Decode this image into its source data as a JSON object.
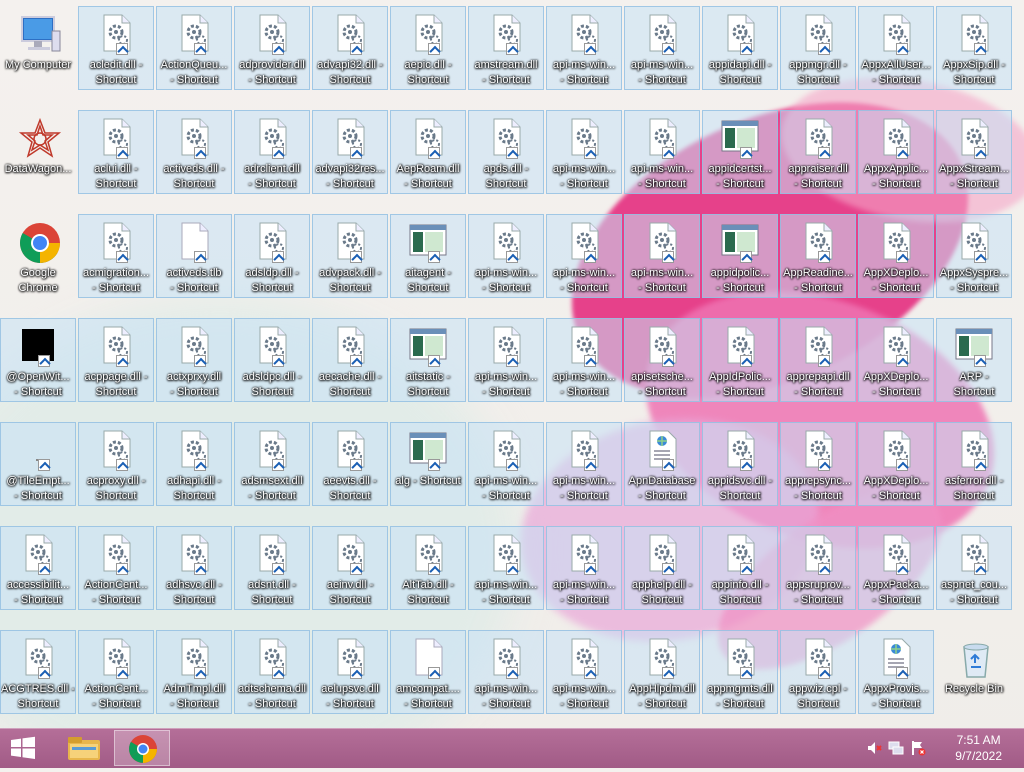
{
  "desktop": {
    "icons": [
      {
        "label": "My Computer",
        "kind": "computer",
        "plain": true
      },
      {
        "label": "acledit.dll -\nShortcut",
        "kind": "dll"
      },
      {
        "label": "ActionQueu...\n- Shortcut",
        "kind": "dll"
      },
      {
        "label": "adprovider.dll\n- Shortcut",
        "kind": "dll"
      },
      {
        "label": "advapi32.dll -\nShortcut",
        "kind": "dll"
      },
      {
        "label": "aepic.dll -\nShortcut",
        "kind": "dll"
      },
      {
        "label": "amstream.dll\n- Shortcut",
        "kind": "dll"
      },
      {
        "label": "api-ms-win...\n- Shortcut",
        "kind": "dll"
      },
      {
        "label": "api-ms-win...\n- Shortcut",
        "kind": "dll"
      },
      {
        "label": "appidapi.dll -\nShortcut",
        "kind": "dll"
      },
      {
        "label": "appmgr.dll -\nShortcut",
        "kind": "dll"
      },
      {
        "label": "AppxAllUser...\n- Shortcut",
        "kind": "dll"
      },
      {
        "label": "AppxSip.dll -\nShortcut",
        "kind": "dll"
      },
      {
        "label": "DataWagon...",
        "kind": "datawagon",
        "plain": true
      },
      {
        "label": "aclui.dll -\nShortcut",
        "kind": "dll"
      },
      {
        "label": "activeds.dll -\nShortcut",
        "kind": "dll"
      },
      {
        "label": "adrclient.dll\n- Shortcut",
        "kind": "dll"
      },
      {
        "label": "advapi32res...\n- Shortcut",
        "kind": "dll"
      },
      {
        "label": "AepRoam.dll\n- Shortcut",
        "kind": "dll"
      },
      {
        "label": "apds.dll -\nShortcut",
        "kind": "dll"
      },
      {
        "label": "api-ms-win...\n- Shortcut",
        "kind": "dll"
      },
      {
        "label": "api-ms-win...\n- Shortcut",
        "kind": "dll"
      },
      {
        "label": "appidcertst...\n- Shortcut",
        "kind": "exe"
      },
      {
        "label": "appraiser.dll\n- Shortcut",
        "kind": "dll"
      },
      {
        "label": "AppxApplic...\n- Shortcut",
        "kind": "dll"
      },
      {
        "label": "AppxStream...\n- Shortcut",
        "kind": "dll"
      },
      {
        "label": "Google\nChrome",
        "kind": "chrome",
        "plain": true
      },
      {
        "label": "acmigration...\n- Shortcut",
        "kind": "dll"
      },
      {
        "label": "activeds.tlb\n- Shortcut",
        "kind": "blank"
      },
      {
        "label": "adsldp.dll -\nShortcut",
        "kind": "dll"
      },
      {
        "label": "advpack.dll -\nShortcut",
        "kind": "dll"
      },
      {
        "label": "aitagent -\nShortcut",
        "kind": "exe"
      },
      {
        "label": "api-ms-win...\n- Shortcut",
        "kind": "dll"
      },
      {
        "label": "api-ms-win...\n- Shortcut",
        "kind": "dll"
      },
      {
        "label": "api-ms-win...\n- Shortcut",
        "kind": "dll"
      },
      {
        "label": "appidpolic...\n- Shortcut",
        "kind": "exe"
      },
      {
        "label": "AppReadine...\n- Shortcut",
        "kind": "dll"
      },
      {
        "label": "AppXDeplo...\n- Shortcut",
        "kind": "dll"
      },
      {
        "label": "AppxSyspre...\n- Shortcut",
        "kind": "dll"
      },
      {
        "label": "@OpenWit...\n- Shortcut",
        "kind": "black"
      },
      {
        "label": "acppage.dll -\nShortcut",
        "kind": "dll"
      },
      {
        "label": "actxprxy.dll\n- Shortcut",
        "kind": "dll"
      },
      {
        "label": "adsldpc.dll -\nShortcut",
        "kind": "dll"
      },
      {
        "label": "aecache.dll -\nShortcut",
        "kind": "dll"
      },
      {
        "label": "aitstatic -\nShortcut",
        "kind": "exe"
      },
      {
        "label": "api-ms-win...\n- Shortcut",
        "kind": "dll"
      },
      {
        "label": "api-ms-win...\n- Shortcut",
        "kind": "dll"
      },
      {
        "label": "apisetsche...\n- Shortcut",
        "kind": "dll"
      },
      {
        "label": "AppIdPolic...\n- Shortcut",
        "kind": "dll"
      },
      {
        "label": "apprepapi.dll\n- Shortcut",
        "kind": "dll"
      },
      {
        "label": "AppXDeplo...\n- Shortcut",
        "kind": "dll"
      },
      {
        "label": "ARP -\nShortcut",
        "kind": "exe"
      },
      {
        "label": "@TileEmpt...\n- Shortcut",
        "kind": "empty"
      },
      {
        "label": "acproxy.dll -\nShortcut",
        "kind": "dll"
      },
      {
        "label": "adhapi.dll -\nShortcut",
        "kind": "dll"
      },
      {
        "label": "adsmsext.dll\n- Shortcut",
        "kind": "dll"
      },
      {
        "label": "aeevts.dll -\nShortcut",
        "kind": "dll"
      },
      {
        "label": "alg - Shortcut",
        "kind": "exe"
      },
      {
        "label": "api-ms-win...\n- Shortcut",
        "kind": "dll"
      },
      {
        "label": "api-ms-win...\n- Shortcut",
        "kind": "dll"
      },
      {
        "label": "ApnDatabase\n- Shortcut",
        "kind": "web"
      },
      {
        "label": "appidsvc.dll -\nShortcut",
        "kind": "dll"
      },
      {
        "label": "apprepsync...\n- Shortcut",
        "kind": "dll"
      },
      {
        "label": "AppXDeplo...\n- Shortcut",
        "kind": "dll"
      },
      {
        "label": "asferror.dll -\nShortcut",
        "kind": "dll"
      },
      {
        "label": "accessibilit...\n- Shortcut",
        "kind": "dll"
      },
      {
        "label": "ActionCent...\n- Shortcut",
        "kind": "dll"
      },
      {
        "label": "adhsvc.dll -\nShortcut",
        "kind": "dll"
      },
      {
        "label": "adsnt.dll -\nShortcut",
        "kind": "dll"
      },
      {
        "label": "aeinv.dll -\nShortcut",
        "kind": "dll"
      },
      {
        "label": "AltTab.dll -\nShortcut",
        "kind": "dll"
      },
      {
        "label": "api-ms-win...\n- Shortcut",
        "kind": "dll"
      },
      {
        "label": "api-ms-win...\n- Shortcut",
        "kind": "dll"
      },
      {
        "label": "apphelp.dll -\nShortcut",
        "kind": "dll"
      },
      {
        "label": "appinfo.dll -\nShortcut",
        "kind": "dll"
      },
      {
        "label": "appsruprov...\n- Shortcut",
        "kind": "dll"
      },
      {
        "label": "AppxPacka...\n- Shortcut",
        "kind": "dll"
      },
      {
        "label": "aspnet_cou...\n- Shortcut",
        "kind": "dll"
      },
      {
        "label": "ACGTRES.dll -\nShortcut",
        "kind": "dll"
      },
      {
        "label": "ActionCent...\n- Shortcut",
        "kind": "dll"
      },
      {
        "label": "AdmTmpl.dll\n- Shortcut",
        "kind": "dll"
      },
      {
        "label": "adtschema.dll\n- Shortcut",
        "kind": "dll"
      },
      {
        "label": "aelupsvc.dll\n- Shortcut",
        "kind": "dll"
      },
      {
        "label": "amcompat....\n- Shortcut",
        "kind": "blank"
      },
      {
        "label": "api-ms-win...\n- Shortcut",
        "kind": "dll"
      },
      {
        "label": "api-ms-win...\n- Shortcut",
        "kind": "dll"
      },
      {
        "label": "AppHlpdm.dll\n- Shortcut",
        "kind": "dll"
      },
      {
        "label": "appmgmts.dll\n- Shortcut",
        "kind": "dll"
      },
      {
        "label": "appwiz.cpl -\nShortcut",
        "kind": "dll"
      },
      {
        "label": "AppxProvis...\n- Shortcut",
        "kind": "web"
      },
      {
        "label": "Recycle Bin",
        "kind": "recycle",
        "plain": true
      }
    ]
  },
  "taskbar": {
    "start_icon": "windows-start-icon",
    "pinned": [
      {
        "name": "file-explorer-icon"
      },
      {
        "name": "chrome-icon",
        "active": true
      }
    ],
    "tray": {
      "icons": [
        "volume-muted-icon",
        "network-icon",
        "action-center-flag-icon"
      ],
      "time": "7:51 AM",
      "date": "9/7/2022"
    }
  },
  "colors": {
    "taskbar": "#a95f8d",
    "icon_highlight": "#c6e1f5"
  }
}
